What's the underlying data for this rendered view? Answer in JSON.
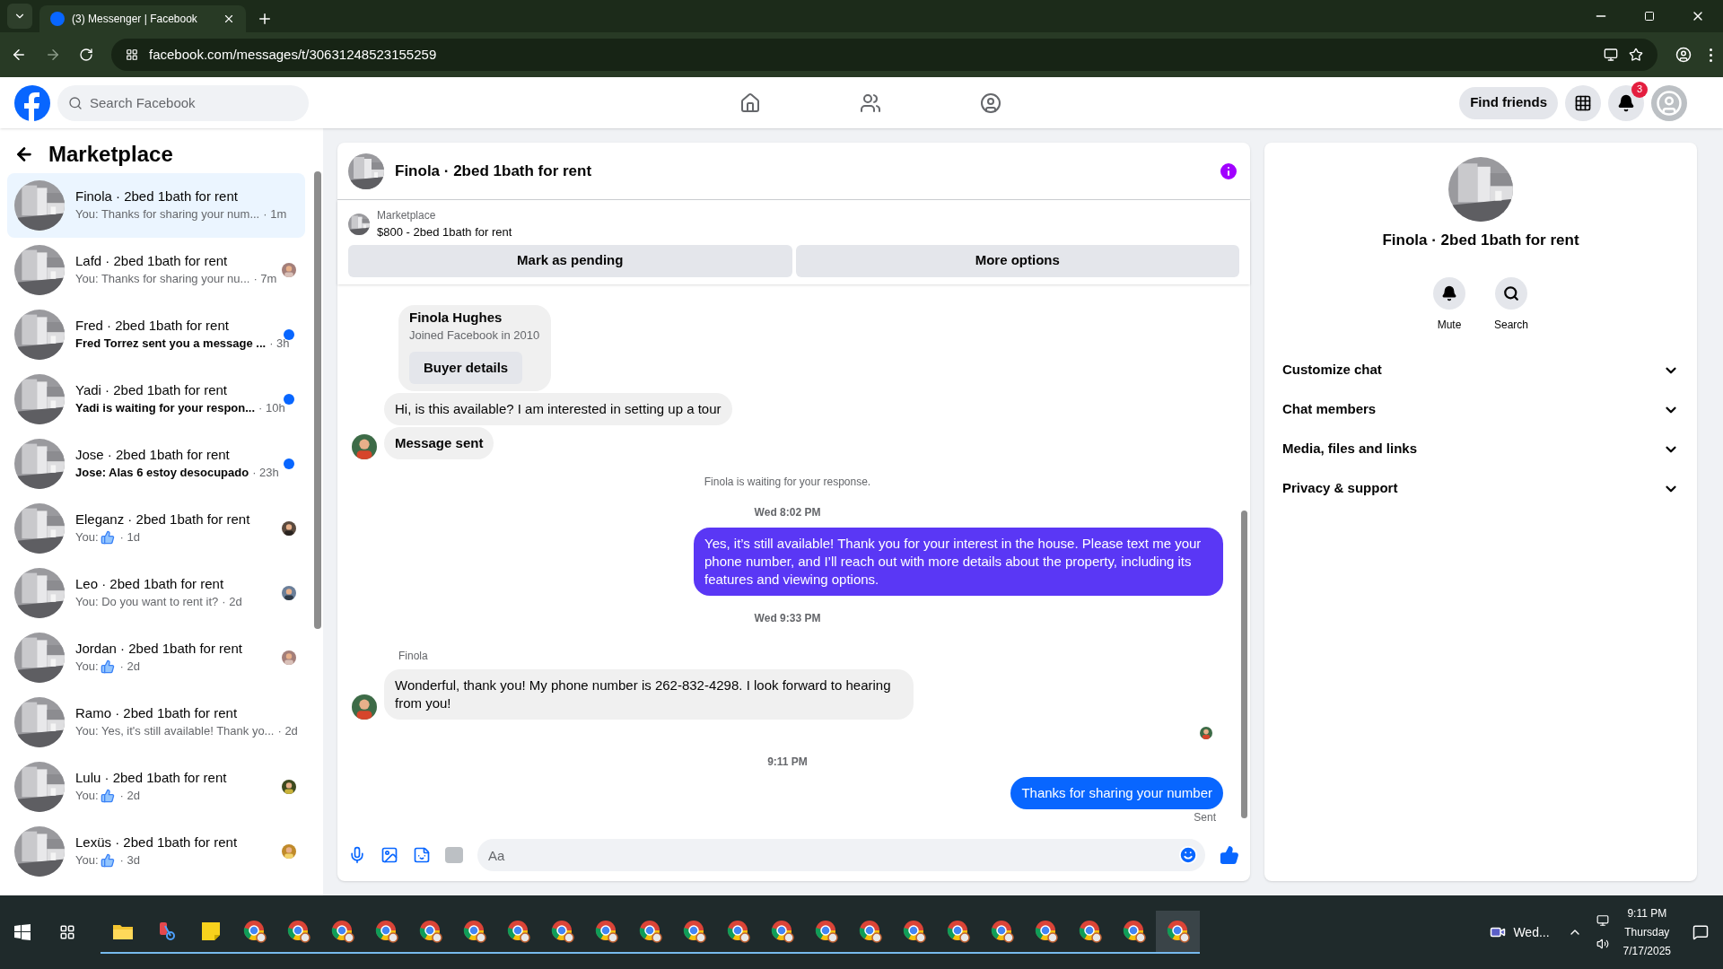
{
  "browser": {
    "tab": {
      "title": "(3) Messenger | Facebook",
      "selected": true
    },
    "url": "facebook.com/messages/t/30631248523155259"
  },
  "header": {
    "search": {
      "placeholder": "Search Facebook"
    },
    "nav": [
      {
        "kind": "home",
        "selected": false
      },
      {
        "kind": "friends",
        "selected": false
      },
      {
        "kind": "groups",
        "selected": false
      }
    ],
    "find_friends": "Find friends",
    "notifications": "3"
  },
  "sidebar": {
    "title": "Marketplace",
    "conversations": [
      {
        "name": "Finola · 2bed 1bath for rent",
        "preview": "You: Thanks for sharing your num...",
        "like": false,
        "time": "· 1m",
        "unread": false,
        "dot": false,
        "seen": false,
        "selected": true
      },
      {
        "name": "Lafd · 2bed 1bath for rent",
        "preview": "You: Thanks for sharing your nu...",
        "like": false,
        "time": "· 7m",
        "unread": false,
        "dot": false,
        "seen": true,
        "selected": false
      },
      {
        "name": "Fred · 2bed 1bath for rent",
        "preview": "Fred Torrez sent you a message ...",
        "like": false,
        "time": "· 3h",
        "unread": true,
        "dot": true,
        "seen": false,
        "selected": false
      },
      {
        "name": "Yadi · 2bed 1bath for rent",
        "preview": "Yadi is waiting for your respon...",
        "like": false,
        "time": "· 10h",
        "unread": true,
        "dot": true,
        "seen": false,
        "selected": false
      },
      {
        "name": "Jose · 2bed 1bath for rent",
        "preview": "Jose: Alas 6 estoy desocupado",
        "like": false,
        "time": "· 23h",
        "unread": true,
        "dot": true,
        "seen": false,
        "selected": false
      },
      {
        "name": "Eleganz · 2bed 1bath for rent",
        "preview": "You:",
        "like": true,
        "time": "· 1d",
        "unread": false,
        "dot": false,
        "seen": true,
        "selected": false
      },
      {
        "name": "Leo · 2bed 1bath for rent",
        "preview": "You: Do you want to rent it?",
        "like": false,
        "time": "· 2d",
        "unread": false,
        "dot": false,
        "seen": true,
        "selected": false
      },
      {
        "name": "Jordan · 2bed 1bath for rent",
        "preview": "You:",
        "like": true,
        "time": "· 2d",
        "unread": false,
        "dot": false,
        "seen": true,
        "selected": false
      },
      {
        "name": "Ramo · 2bed 1bath for rent",
        "preview": "You: Yes, it's still available! Thank yo...",
        "like": false,
        "time": "· 2d",
        "unread": false,
        "dot": false,
        "seen": false,
        "selected": false
      },
      {
        "name": "Lulu · 2bed 1bath for rent",
        "preview": "You:",
        "like": true,
        "time": "· 2d",
        "unread": false,
        "dot": false,
        "seen": true,
        "selected": false
      },
      {
        "name": "Lexüs · 2bed 1bath for rent",
        "preview": "You:",
        "like": true,
        "time": "· 3d",
        "unread": false,
        "dot": false,
        "seen": true,
        "selected": false
      }
    ]
  },
  "chat": {
    "title": "Finola · 2bed 1bath for rent",
    "listing": {
      "label": "Marketplace",
      "title": "$800 - 2bed 1bath for rent"
    },
    "actions": [
      "Mark as pending",
      "More options"
    ],
    "messages": [
      {
        "kind": "profile_card",
        "name": "Finola Hughes",
        "subtitle": "Joined Facebook in 2010",
        "button": "Buyer details"
      },
      {
        "kind": "incoming",
        "text": "Hi, is this available? I am interested in setting up a tour",
        "avatar": false,
        "bold": false
      },
      {
        "kind": "incoming",
        "text": "Message sent",
        "avatar": true,
        "bold": true
      },
      {
        "kind": "notice",
        "text": "Finola is waiting for your response."
      },
      {
        "kind": "time",
        "text": "Wed 8:02 PM"
      },
      {
        "kind": "outgoing",
        "text": "Yes, it’s still available! Thank you for your interest in the house. Please text me your phone number, and I’ll reach out with more details about the property, including its features and viewing options.",
        "color": "#5a37f5"
      },
      {
        "kind": "time",
        "text": "Wed 9:33 PM"
      },
      {
        "kind": "sender",
        "text": "Finola"
      },
      {
        "kind": "incoming",
        "text": "Wonderful, thank you! My phone number is 262-832-4298. I look forward to hearing from you!",
        "avatar": true,
        "bold": false
      },
      {
        "kind": "seen"
      },
      {
        "kind": "time",
        "text": "9:11 PM"
      },
      {
        "kind": "outgoing",
        "text": "Thanks for sharing your number",
        "color": "#0866ff"
      },
      {
        "kind": "status",
        "text": "Sent"
      }
    ],
    "composer": {
      "placeholder": "Aa"
    }
  },
  "details": {
    "title": "Finola · 2bed 1bath for rent",
    "actions": [
      {
        "kind": "mute",
        "label": "Mute"
      },
      {
        "kind": "search",
        "label": "Search"
      }
    ],
    "sections": [
      {
        "label": "Customize chat",
        "expanded": false
      },
      {
        "label": "Chat members",
        "expanded": false
      },
      {
        "label": "Media, files and links",
        "expanded": false
      },
      {
        "label": "Privacy & support",
        "expanded": false
      }
    ]
  },
  "taskbar": {
    "apps": [
      {
        "kind": "folder",
        "selected": false
      },
      {
        "kind": "snip",
        "selected": false
      },
      {
        "kind": "notes",
        "selected": false
      },
      {
        "kind": "browser",
        "selected": false
      },
      {
        "kind": "browser",
        "selected": false
      },
      {
        "kind": "browser",
        "selected": false
      },
      {
        "kind": "browser",
        "selected": false
      },
      {
        "kind": "browser",
        "selected": false
      },
      {
        "kind": "browser",
        "selected": false
      },
      {
        "kind": "browser",
        "selected": false
      },
      {
        "kind": "browser",
        "selected": false
      },
      {
        "kind": "browser",
        "selected": false
      },
      {
        "kind": "browser",
        "selected": false
      },
      {
        "kind": "browser",
        "selected": false
      },
      {
        "kind": "browser",
        "selected": false
      },
      {
        "kind": "browser",
        "selected": false
      },
      {
        "kind": "browser",
        "selected": false
      },
      {
        "kind": "browser",
        "selected": false
      },
      {
        "kind": "browser",
        "selected": false
      },
      {
        "kind": "browser",
        "selected": false
      },
      {
        "kind": "browser",
        "selected": false
      },
      {
        "kind": "browser",
        "selected": false
      },
      {
        "kind": "browser",
        "selected": false
      },
      {
        "kind": "browser",
        "selected": false
      },
      {
        "kind": "browser",
        "selected": true
      }
    ],
    "meeting": "Wed...",
    "time": "9:11 PM",
    "day": "Thursday",
    "date": "7/17/2025"
  }
}
